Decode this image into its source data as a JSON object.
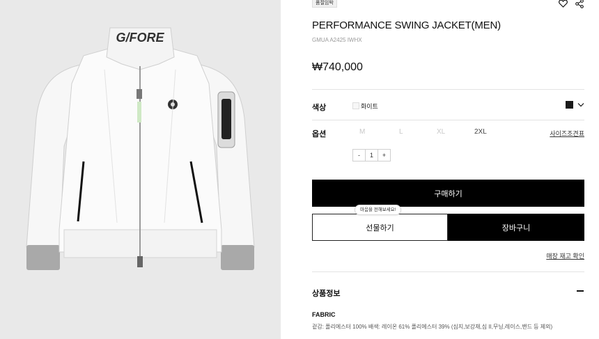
{
  "badge": "품절임박",
  "product": {
    "title": "PERFORMANCE SWING JACKET(MEN)",
    "sku": "GMUA A2425 IWHX",
    "price": "₩740,000",
    "image_text": "G/FORE"
  },
  "color": {
    "label": "색상",
    "selected": "화이트",
    "swatch_color": "#1a1a1a"
  },
  "option": {
    "label": "옵션",
    "sizes": [
      "M",
      "L",
      "XL",
      "2XL"
    ],
    "size_guide": "사이즈조견표"
  },
  "quantity": {
    "minus": "-",
    "value": "1",
    "plus": "+"
  },
  "buttons": {
    "buy": "구매하기",
    "gift": "선물하기",
    "gift_tooltip": "마음을 전해보세요!",
    "cart": "장바구니",
    "store_stock": "매장 재고 확인"
  },
  "details": {
    "section_title": "상품정보",
    "fabric_title": "FABRIC",
    "fabric_text": "겉감: 폴리에스터 100% 배색: 레이온 61% 폴리에스터 39% (심지,보강재,심 II,무닝,레이스,밴드 등 제외)"
  },
  "icons": {
    "wishlist": "heart-icon",
    "share": "share-icon",
    "dropdown": "chevron-down-icon"
  }
}
